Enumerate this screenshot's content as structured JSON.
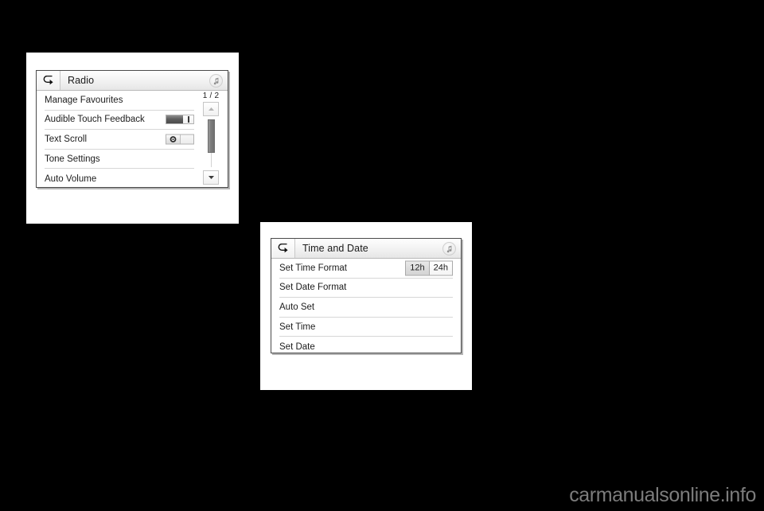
{
  "page": {
    "background_color": "#000000",
    "watermark": "carmanualsonline.info"
  },
  "figures": [
    {
      "id": "radio",
      "screen": {
        "titlebar": {
          "back_icon": "back-arrow-icon",
          "title": "Radio",
          "audio_icon": "music-note-icon"
        },
        "rows": [
          {
            "label": "Manage Favourites",
            "control": "none"
          },
          {
            "label": "Audible Touch Feedback",
            "control": "slider"
          },
          {
            "label": "Text Scroll",
            "control": "toggle"
          },
          {
            "label": "Tone Settings",
            "control": "none"
          },
          {
            "label": "Auto Volume",
            "control": "none"
          }
        ],
        "scrollbar": {
          "page_indicator": "1 / 2",
          "up_icon": "chevron-up-icon",
          "down_icon": "chevron-down-icon",
          "thumb_position": "top"
        },
        "slider": {
          "value_fill_percent": 58,
          "knob_icon": "slider-knob-icon"
        },
        "toggle": {
          "state": "off",
          "thumb_icon": "circle-dot-icon"
        }
      }
    },
    {
      "id": "timedate",
      "screen": {
        "titlebar": {
          "back_icon": "back-arrow-icon",
          "title": "Time and Date",
          "audio_icon": "music-note-icon"
        },
        "rows": [
          {
            "label": "Set Time Format",
            "control": "segmented"
          },
          {
            "label": "Set Date Format",
            "control": "none"
          },
          {
            "label": "Auto Set",
            "control": "none"
          },
          {
            "label": "Set Time",
            "control": "none"
          },
          {
            "label": "Set Date",
            "control": "none"
          }
        ],
        "time_format": {
          "options": [
            "12h",
            "24h"
          ],
          "selected": "12h"
        }
      }
    }
  ],
  "colors": {
    "screen_background": "#ffffff",
    "bezel_border": "#4a4a4a",
    "titlebar_gradient_top": "#fefefe",
    "titlebar_gradient_bottom": "#e6e6e6",
    "divider": "#d7d7d7",
    "text": "#1c1c1c",
    "slider_fill": "#5e5e5e",
    "scroll_thumb": "#7d7d7d",
    "watermark": "#7c7c7c"
  }
}
